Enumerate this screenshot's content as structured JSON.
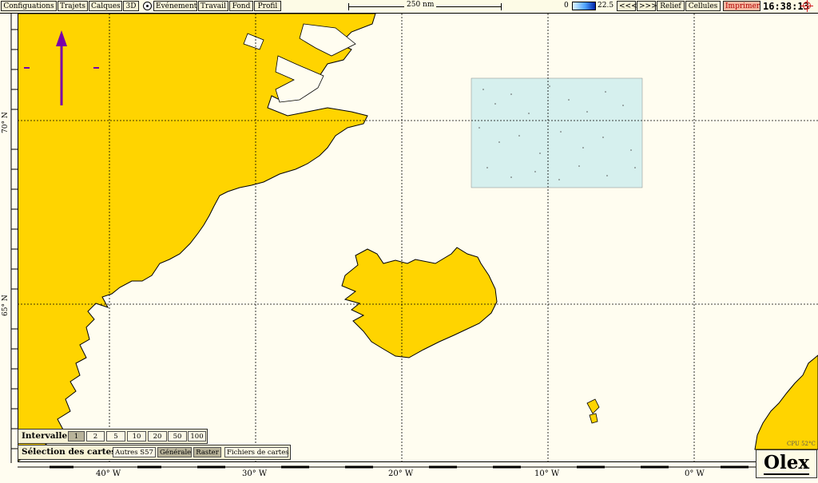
{
  "menu": {
    "items": [
      "Configuations",
      "Trajets",
      "Calques",
      "3D",
      "Evénement",
      "Travail",
      "Fond",
      "Profil"
    ],
    "scale_label": "250 nm",
    "depth_min": "0",
    "depth_max": "22.5",
    "prev": "<<<",
    "next": ">>>",
    "relief": "Relief",
    "cells": "Cellules",
    "print": "Imprimer",
    "clock": "16:38:13"
  },
  "map": {
    "lat_labels": [
      "70° N",
      "65° N"
    ],
    "lon_labels": [
      "40° W",
      "30° W",
      "20° W",
      "10° W",
      "0° W"
    ],
    "land_color": "#ffd400",
    "sea_color": "#fffdf0",
    "raster_color": "#d6f0ee",
    "cpu": "CPU 52°C"
  },
  "panels": {
    "interval_title": "Intervalle",
    "interval_values": [
      "1",
      "2",
      "5",
      "10",
      "20",
      "50",
      "100"
    ],
    "interval_selected": "1",
    "charts_title": "Sélection des cartes",
    "chart_buttons": [
      "Autres S57",
      "Générale",
      "Raster",
      "Fichiers de cartes"
    ],
    "chart_active": [
      "Générale",
      "Raster"
    ]
  },
  "logo": "Olex"
}
